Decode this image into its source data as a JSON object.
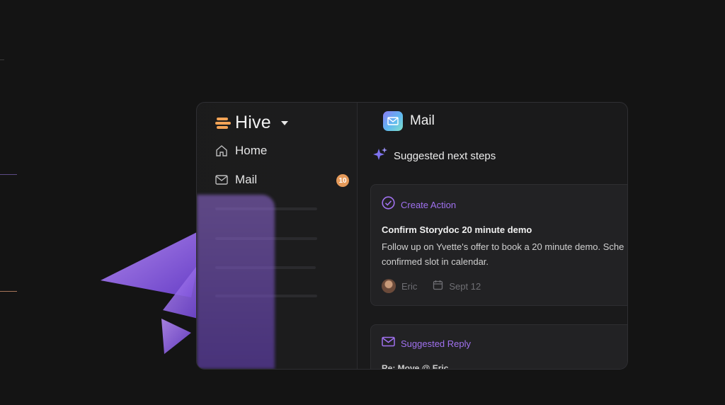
{
  "sidebar": {
    "brand_name": "Hive",
    "nav_items": [
      {
        "label": "Home",
        "icon": "home-icon"
      },
      {
        "label": "Mail",
        "icon": "mail-icon"
      }
    ],
    "mail_badge": "10"
  },
  "main": {
    "app_title": "Mail",
    "suggested_heading": "Suggested next steps",
    "cards": [
      {
        "type_label": "Create Action",
        "icon": "check-circle-icon",
        "title": "Confirm Storydoc 20 minute demo",
        "body_line1": "Follow up on Yvette's offer to book a 20 minute demo. Sche",
        "body_line2": "confirmed slot in calendar.",
        "assignee": "Eric",
        "date": "Sept 12"
      },
      {
        "type_label": "Suggested Reply",
        "icon": "envelope-icon",
        "subject_partial": "Re: Move @ Eric"
      }
    ]
  },
  "colors": {
    "accent_purple": "#a071ef",
    "badge_orange": "#e59a5a",
    "brand_orange": "#f2a356",
    "background": "#141414"
  }
}
